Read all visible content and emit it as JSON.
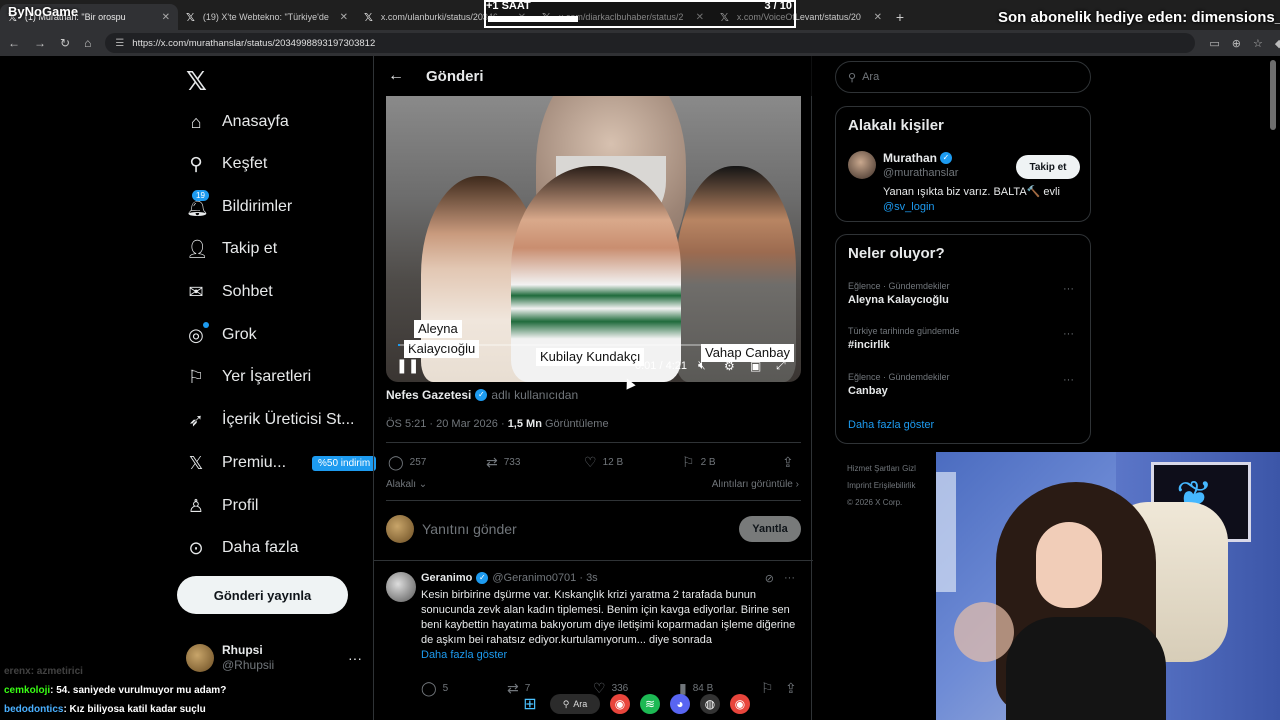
{
  "browser": {
    "tabs": [
      {
        "label": "(1) Murathan: \"Bir orospu",
        "active": true
      },
      {
        "label": "(19) X'te Webtekno: \"Türkiye'de",
        "active": false
      },
      {
        "label": "x.com/ulanburki/status/20346",
        "active": false
      },
      {
        "label": "x.com/diarkaclbuhaber/status/2",
        "active": false
      },
      {
        "label": "x.com/VoiceOfLevant/status/20",
        "active": false
      }
    ],
    "url": "https://x.com/murathanslar/status/2034998893197303812"
  },
  "overlays": {
    "logo_text": "ByNoGame",
    "timer_label": "+1 SAAT",
    "timer_count": "3 / 10",
    "subscription_banner": "Son abonelik hediye eden: dimensions_xyz"
  },
  "leftnav": {
    "items": [
      {
        "label": "Anasayfa",
        "icon": "home-icon"
      },
      {
        "label": "Keşfet",
        "icon": "search-icon"
      },
      {
        "label": "Bildirimler",
        "icon": "bell-icon",
        "badge": "19"
      },
      {
        "label": "Takip et",
        "icon": "person-add-icon"
      },
      {
        "label": "Sohbet",
        "icon": "mail-icon"
      },
      {
        "label": "Grok",
        "icon": "grok-icon"
      },
      {
        "label": "Yer İşaretleri",
        "icon": "bookmark-icon"
      },
      {
        "label": "İçerik Üreticisi St...",
        "icon": "rocket-icon"
      },
      {
        "label": "Premiu...",
        "icon": "x-icon",
        "tag": "%50 indirim"
      },
      {
        "label": "Profil",
        "icon": "profile-icon"
      },
      {
        "label": "Daha fazla",
        "icon": "more-circle-icon"
      }
    ],
    "post_button": "Gönderi yayınla",
    "account": {
      "name": "Rhupsi",
      "handle": "@Rhupsii"
    }
  },
  "main": {
    "header_title": "Gönderi",
    "video": {
      "labels": [
        "Aleyna",
        "Kalaycıoğlu",
        "Kubilay Kundakçı",
        "Vahap Canbay"
      ],
      "time": "0:01 / 4:21",
      "progress": 0.004
    },
    "source": {
      "name": "Nefes Gazetesi",
      "suffix": "adlı kullanıcıdan"
    },
    "meta": {
      "time": "ÖS 5:21 · 20 Mar 2026 ·",
      "views": "1,5 Mn",
      "views_label": "Görüntüleme"
    },
    "stats": {
      "replies": "257",
      "reposts": "733",
      "likes": "12 B",
      "bookmarks": "2 B"
    },
    "related": "Alakalı",
    "quotes": "Alıntıları görüntüle",
    "reply_placeholder": "Yanıtını gönder",
    "reply_button": "Yanıtla",
    "comment": {
      "name": "Geranimo",
      "handle": "@Geranimo0701 · 3s",
      "text": "Kesin birbirine dşürme var. Kıskançlık krizi yaratma 2 tarafada bunun sonucunda zevk alan kadın tiplemesi. Benim için kavga ediyorlar. Birine sen beni kaybettin hayatıma bakıyorum diye iletişimi koparmadan işleme diğerine de aşkım bei rahatsız ediyor.kurtulamıyorum... diye sonrada",
      "more": "Daha fazla göster",
      "stats": {
        "replies": "5",
        "reposts": "7",
        "likes": "336",
        "views": "84 B"
      }
    }
  },
  "right": {
    "search_placeholder": "Ara",
    "related_people": {
      "title": "Alakalı kişiler",
      "name": "Murathan",
      "handle": "@murathanslar",
      "bio": "Yanan ışıkta biz varız. BALTA🔨 evli",
      "link": "@sv_login",
      "follow": "Takip et"
    },
    "trends": {
      "title": "Neler oluyor?",
      "items": [
        {
          "context": "Eğlence · Gündemdekiler",
          "name": "Aleyna Kalaycıoğlu"
        },
        {
          "context": "Türkiye tarihinde gündemde",
          "name": "#incirlik"
        },
        {
          "context": "Eğlence · Gündemdekiler",
          "name": "Canbay"
        }
      ],
      "show_more": "Daha fazla göster"
    },
    "footer": [
      "Hizmet Şartları",
      "Gizl",
      "Imprint",
      "Erişilebilirlik",
      "© 2026 X Corp."
    ]
  },
  "chat": [
    {
      "user": "cemkoloji",
      "msg": ": 54. saniyede vurulmuyor mu adam?"
    },
    {
      "user": "bedodontics",
      "msg": ": Kız biliyosa katil kadar suçlu"
    }
  ],
  "chat_faded": {
    "user": "erenx",
    "msg": ": azmetirici"
  },
  "taskbar": {
    "search": "Ara"
  }
}
